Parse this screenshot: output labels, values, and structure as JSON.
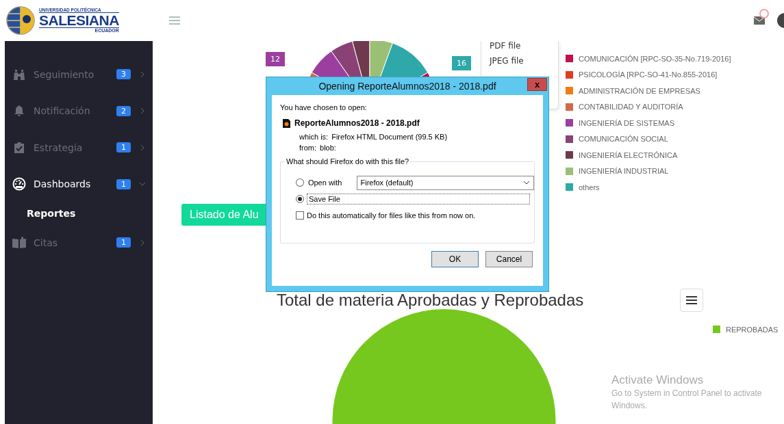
{
  "header": {
    "logo": {
      "line_1": "UNIVERSIDAD POLITÉCNICA",
      "line_2": "SALESIANA",
      "line_3": "ECUADOR"
    },
    "notification_dot": true
  },
  "sidebar": {
    "items": [
      {
        "label": "Seguimiento",
        "badge": "3",
        "selected": false,
        "expanded": false
      },
      {
        "label": "Notificación",
        "badge": "2",
        "selected": false,
        "expanded": false
      },
      {
        "label": "Estrategia",
        "badge": "1",
        "selected": false,
        "expanded": false
      },
      {
        "label": "Dashboards",
        "badge": "1",
        "selected": true,
        "expanded": true,
        "children": [
          {
            "label": "Reportes"
          }
        ]
      },
      {
        "label": "Citas",
        "badge": "1",
        "selected": false,
        "expanded": false
      }
    ]
  },
  "chart_1": {
    "data_labels": [
      {
        "text": "12",
        "color": "#9b3f9e"
      },
      {
        "text": "16",
        "color": "#2ea8a8"
      }
    ],
    "export_menu": [
      "PDF file",
      "JPEG file"
    ],
    "legend": [
      {
        "label": "COMUNICACIÓN [RPC-SO-35-No.719-2016]",
        "color": "#c0114f"
      },
      {
        "label": "PSICOLOGÍA [RPC-SO-41-No.855-2016]",
        "color": "#e03c24"
      },
      {
        "label": "ADMINISTRACIÓN DE EMPRESAS",
        "color": "#f07c10"
      },
      {
        "label": "CONTABILIDAD Y AUDITORÍA",
        "color": "#d2694a"
      },
      {
        "label": "INGENIERÍA DE SISTEMAS",
        "color": "#9b3f9e"
      },
      {
        "label": "COMUNICACIÓN SOCIAL",
        "color": "#8a4276"
      },
      {
        "label": "INGENIERÍA ELECTRÓNICA",
        "color": "#6f3a4d"
      },
      {
        "label": "INGENIERÍA INDUSTRIAL",
        "color": "#9cbf76"
      },
      {
        "label": "others",
        "color": "#2ea8a8"
      }
    ]
  },
  "list_button": "Listado de Alu",
  "chart_2": {
    "title": "Total de materia Aprobadas y Reprobadas",
    "legend": [
      {
        "label": "REPROBADAS",
        "color": "#76c81e"
      }
    ]
  },
  "dialog": {
    "title": "Opening ReporteAlumnos2018 - 2018.pdf",
    "close": "x",
    "intro": "You have chosen to open:",
    "file_name": "ReporteAlumnos2018 - 2018.pdf",
    "which_is_label": "which is:",
    "which_is_value": "Firefox HTML Document (99.5 KB)",
    "from_label": "from:",
    "from_value": "blob:",
    "group_label": "What should Firefox do with this file?",
    "options": [
      {
        "label": "Open with",
        "selected": false,
        "app": "Firefox (default)"
      },
      {
        "label": "Save File",
        "selected": true
      }
    ],
    "auto_checkbox": {
      "label": "Do this automatically for files like this from now on.",
      "checked": false
    },
    "buttons": [
      "OK",
      "Cancel"
    ]
  },
  "os_notice": {
    "title": "Activate Windows",
    "text": "Go to System in Control Panel to activate\nWindows."
  }
}
